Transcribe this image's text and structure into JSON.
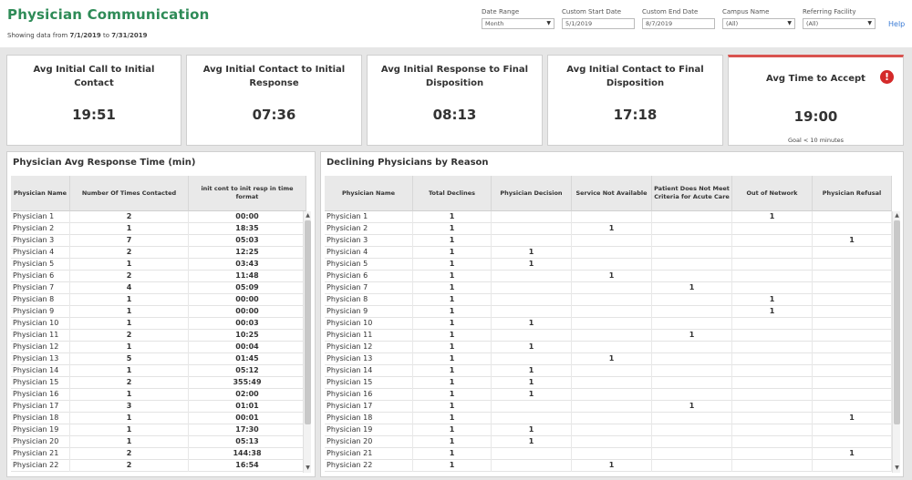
{
  "header": {
    "title": "Physician Communication",
    "subtitle_prefix": "Showing data from ",
    "start": "7/1/2019",
    "mid": " to ",
    "end": "7/31/2019",
    "help": "Help"
  },
  "filters": [
    {
      "label": "Date Range",
      "value": "Month",
      "type": "select"
    },
    {
      "label": "Custom Start Date",
      "value": "5/1/2019",
      "type": "input"
    },
    {
      "label": "Custom End Date",
      "value": "8/7/2019",
      "type": "input"
    },
    {
      "label": "Campus Name",
      "value": "(All)",
      "type": "select"
    },
    {
      "label": "Referring Facility",
      "value": "(All)",
      "type": "select"
    }
  ],
  "kpis": [
    {
      "title": "Avg Initial Call to Initial Contact",
      "value": "19:51"
    },
    {
      "title": "Avg Initial Contact to Initial Response",
      "value": "07:36"
    },
    {
      "title": "Avg Initial Response to Final Disposition",
      "value": "08:13"
    },
    {
      "title": "Avg Initial Contact to Final Disposition",
      "value": "17:18"
    },
    {
      "title": "Avg Time to Accept",
      "value": "19:00",
      "goal": "Goal < 10 minutes",
      "icon": "alert-icon",
      "alert_color": "#d42a2a"
    }
  ],
  "response_table": {
    "title": "Physician Avg Response Time (min)",
    "columns": [
      "Physician Name",
      "Number Of Times Contacted",
      "init cont to init resp in time format"
    ],
    "rows": [
      [
        "Physician 1",
        "2",
        "00:00"
      ],
      [
        "Physician 2",
        "1",
        "18:35"
      ],
      [
        "Physician 3",
        "7",
        "05:03"
      ],
      [
        "Physician 4",
        "2",
        "12:25"
      ],
      [
        "Physician 5",
        "1",
        "03:43"
      ],
      [
        "Physician 6",
        "2",
        "11:48"
      ],
      [
        "Physician 7",
        "4",
        "05:09"
      ],
      [
        "Physician 8",
        "1",
        "00:00"
      ],
      [
        "Physician 9",
        "1",
        "00:00"
      ],
      [
        "Physician 10",
        "1",
        "00:03"
      ],
      [
        "Physician 11",
        "2",
        "10:25"
      ],
      [
        "Physician 12",
        "1",
        "00:04"
      ],
      [
        "Physician 13",
        "5",
        "01:45"
      ],
      [
        "Physician 14",
        "1",
        "05:12"
      ],
      [
        "Physician 15",
        "2",
        "355:49"
      ],
      [
        "Physician 16",
        "1",
        "02:00"
      ],
      [
        "Physician 17",
        "3",
        "01:01"
      ],
      [
        "Physician 18",
        "1",
        "00:01"
      ],
      [
        "Physician 19",
        "1",
        "17:30"
      ],
      [
        "Physician 20",
        "1",
        "05:13"
      ],
      [
        "Physician 21",
        "2",
        "144:38"
      ],
      [
        "Physician 22",
        "2",
        "16:54"
      ]
    ]
  },
  "decline_table": {
    "title": "Declining Physicians by Reason",
    "columns": [
      "Physician Name",
      "Total Declines",
      "Physician Decision",
      "Service Not Available",
      "Patient Does Not Meet Criteria for Acute Care",
      "Out of Network",
      "Physician Refusal"
    ],
    "rows": [
      [
        "Physician 1",
        "1",
        "",
        "",
        "",
        "1",
        ""
      ],
      [
        "Physician 2",
        "1",
        "",
        "1",
        "",
        "",
        ""
      ],
      [
        "Physician 3",
        "1",
        "",
        "",
        "",
        "",
        "1"
      ],
      [
        "Physician 4",
        "1",
        "1",
        "",
        "",
        "",
        ""
      ],
      [
        "Physician 5",
        "1",
        "1",
        "",
        "",
        "",
        ""
      ],
      [
        "Physician 6",
        "1",
        "",
        "1",
        "",
        "",
        ""
      ],
      [
        "Physician 7",
        "1",
        "",
        "",
        "1",
        "",
        ""
      ],
      [
        "Physician 8",
        "1",
        "",
        "",
        "",
        "1",
        ""
      ],
      [
        "Physician 9",
        "1",
        "",
        "",
        "",
        "1",
        ""
      ],
      [
        "Physician 10",
        "1",
        "1",
        "",
        "",
        "",
        ""
      ],
      [
        "Physician 11",
        "1",
        "",
        "",
        "1",
        "",
        ""
      ],
      [
        "Physician 12",
        "1",
        "1",
        "",
        "",
        "",
        ""
      ],
      [
        "Physician 13",
        "1",
        "",
        "1",
        "",
        "",
        ""
      ],
      [
        "Physician 14",
        "1",
        "1",
        "",
        "",
        "",
        ""
      ],
      [
        "Physician 15",
        "1",
        "1",
        "",
        "",
        "",
        ""
      ],
      [
        "Physician 16",
        "1",
        "1",
        "",
        "",
        "",
        ""
      ],
      [
        "Physician 17",
        "1",
        "",
        "",
        "1",
        "",
        ""
      ],
      [
        "Physician 18",
        "1",
        "",
        "",
        "",
        "",
        "1"
      ],
      [
        "Physician 19",
        "1",
        "1",
        "",
        "",
        "",
        ""
      ],
      [
        "Physician 20",
        "1",
        "1",
        "",
        "",
        "",
        ""
      ],
      [
        "Physician 21",
        "1",
        "",
        "",
        "",
        "",
        "1"
      ],
      [
        "Physician 22",
        "1",
        "",
        "1",
        "",
        "",
        ""
      ]
    ]
  },
  "colors": {
    "title_green": "#2e8b57",
    "help_blue": "#3a7bd5"
  }
}
